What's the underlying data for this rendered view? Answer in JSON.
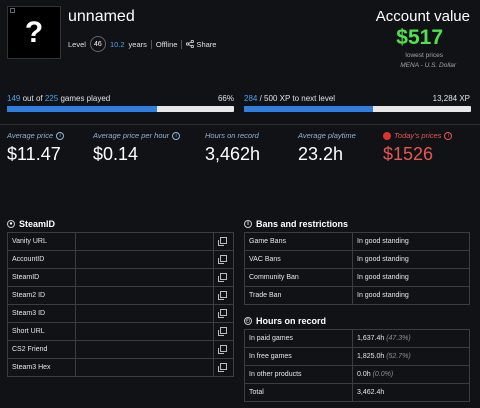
{
  "profile": {
    "avatar_glyph": "?",
    "name": "unnamed",
    "level_label": "Level",
    "level": "46",
    "years_num": "10.2",
    "years_label": "years",
    "status": "Offline",
    "share_label": "Share"
  },
  "account": {
    "title": "Account value",
    "value": "$517",
    "subtitle": "lowest prices",
    "currency": "MENA - U.S. Dollar"
  },
  "games_progress": {
    "played": "149",
    "out_of_text": "out of",
    "total": "225",
    "suffix": "games played",
    "percent_text": "66%",
    "fraction": 0.66
  },
  "xp_progress": {
    "current": "284",
    "rest": "/ 500 XP to next level",
    "total_xp": "13,284 XP",
    "fraction": 0.568
  },
  "stats": [
    {
      "label": "Average price",
      "value": "$11.47"
    },
    {
      "label": "Average price per hour",
      "value": "$0.14"
    },
    {
      "label": "Hours on record",
      "value": "3,462h"
    },
    {
      "label": "Average playtime",
      "value": "23.2h"
    },
    {
      "label": "Today's prices",
      "value": "$1526"
    }
  ],
  "steamid": {
    "title": "SteamID",
    "rows": [
      "Vanity URL",
      "AccountID",
      "SteamID",
      "Steam2 ID",
      "Steam3 ID",
      "Short URL",
      "CS2 Friend",
      "Steam3 Hex"
    ]
  },
  "bans": {
    "title": "Bans and restrictions",
    "rows": [
      {
        "label": "Game Bans",
        "value": "In good standing"
      },
      {
        "label": "VAC Bans",
        "value": "In good standing"
      },
      {
        "label": "Community Ban",
        "value": "In good standing"
      },
      {
        "label": "Trade Ban",
        "value": "In good standing"
      }
    ]
  },
  "hours": {
    "title": "Hours on record",
    "rows": [
      {
        "label": "In paid games",
        "value": "1,637.4h",
        "pct": "(47.3%)"
      },
      {
        "label": "In free games",
        "value": "1,825.0h",
        "pct": "(52.7%)"
      },
      {
        "label": "In other products",
        "value": "0.0h",
        "pct": "(0.0%)"
      },
      {
        "label": "Total",
        "value": "3,462.4h",
        "pct": ""
      }
    ]
  },
  "colors": {
    "accent_blue": "#2f7fe0",
    "account_value_green": "#4ee34e",
    "today_price_red": "#e5584f"
  }
}
